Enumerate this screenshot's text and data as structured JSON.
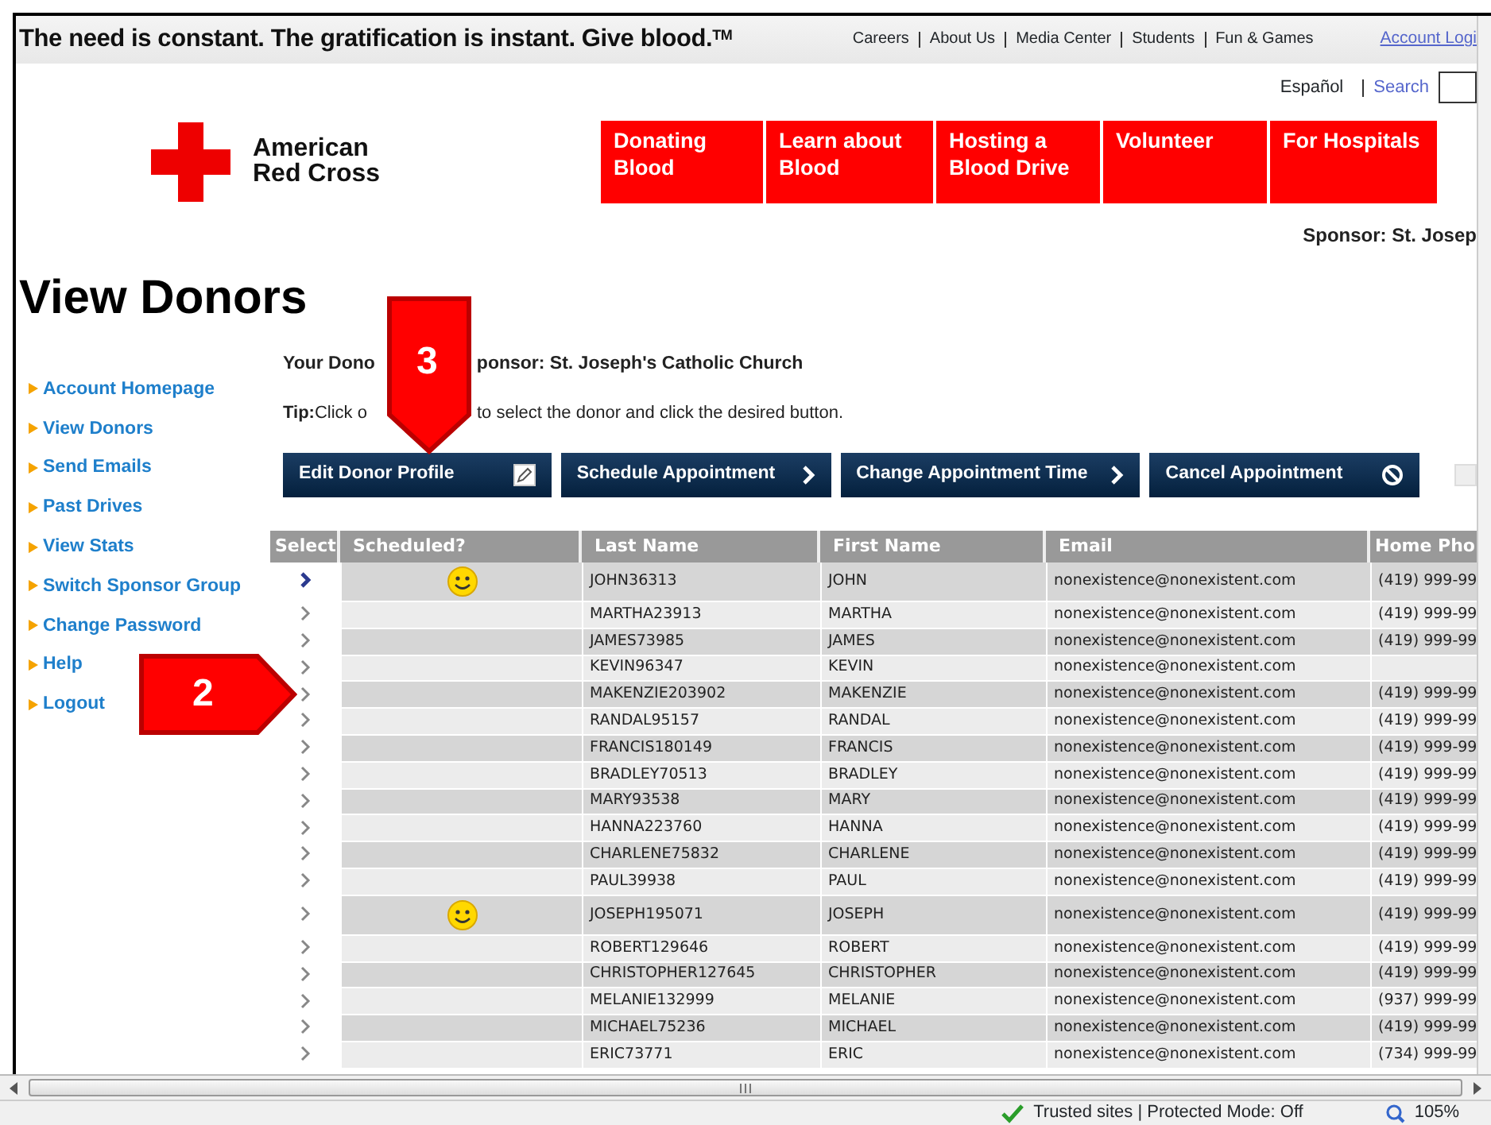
{
  "top_bar": {
    "tagline": "The need is constant. The gratification is instant. Give blood.$^{TM}$",
    "links": [
      "Careers",
      "About Us",
      "Media Center",
      "Students",
      "Fun & Games"
    ],
    "account_link": "Account Logi"
  },
  "utility_links": {
    "language": "Español",
    "search": "Search"
  },
  "logo": {
    "line1": "American",
    "line2": "Red Cross"
  },
  "main_nav": [
    {
      "label": "Donating Blood"
    },
    {
      "label": "Learn about Blood"
    },
    {
      "label": "Hosting a Blood Drive"
    },
    {
      "label": "Volunteer"
    },
    {
      "label": "For Hospitals"
    }
  ],
  "sponsor_heading": "Sponsor: St. Josep",
  "page_title": "View Donors",
  "sidebar": {
    "items": [
      "Account Homepage",
      "View Donors",
      "Send Emails",
      "Past Drives",
      "View Stats",
      "Switch Sponsor Group",
      "Change Password",
      "Help",
      "Logout"
    ]
  },
  "intro": {
    "parts": [
      "Your Dono",
      "ponsor: St. Joseph's Catholic Church"
    ]
  },
  "tip": {
    "label": "Tip:",
    "parts": [
      "Click o",
      "to select the donor and click the desired button."
    ]
  },
  "actions": [
    {
      "label": "Edit Donor Profile",
      "kind": "edit"
    },
    {
      "label": "Schedule Appointment",
      "kind": "next"
    },
    {
      "label": "Change Appointment Time",
      "kind": "next"
    },
    {
      "label": "Cancel Appointment",
      "kind": "cancel"
    }
  ],
  "table": {
    "columns": [
      "Select",
      "Scheduled?",
      "Last Name",
      "First Name",
      "Email",
      "Home Pho"
    ],
    "rows": [
      {
        "selected": true,
        "scheduled": true,
        "last": "JOHN36313",
        "first": "JOHN",
        "email": "nonexistence@nonexistent.com",
        "phone": "(419) 999-99"
      },
      {
        "selected": false,
        "scheduled": false,
        "last": "MARTHA23913",
        "first": "MARTHA",
        "email": "nonexistence@nonexistent.com",
        "phone": "(419) 999-99"
      },
      {
        "selected": false,
        "scheduled": false,
        "last": "JAMES73985",
        "first": "JAMES",
        "email": "nonexistence@nonexistent.com",
        "phone": "(419) 999-99"
      },
      {
        "selected": false,
        "scheduled": false,
        "last": "KEVIN96347",
        "first": "KEVIN",
        "email": "nonexistence@nonexistent.com"
      },
      {
        "selected": false,
        "scheduled": false,
        "last": "MAKENZIE203902",
        "first": "MAKENZIE",
        "email": "nonexistence@nonexistent.com",
        "phone": "(419) 999-99"
      },
      {
        "selected": false,
        "scheduled": false,
        "last": "RANDAL95157",
        "first": "RANDAL",
        "email": "nonexistence@nonexistent.com",
        "phone": "(419) 999-99"
      },
      {
        "selected": false,
        "scheduled": false,
        "last": "FRANCIS180149",
        "first": "FRANCIS",
        "email": "nonexistence@nonexistent.com",
        "phone": "(419) 999-99"
      },
      {
        "selected": false,
        "scheduled": false,
        "last": "BRADLEY70513",
        "first": "BRADLEY",
        "email": "nonexistence@nonexistent.com",
        "phone": "(419) 999-99"
      },
      {
        "selected": false,
        "scheduled": false,
        "last": "MARY93538",
        "first": "MARY",
        "email": "nonexistence@nonexistent.com",
        "phone": "(419) 999-99"
      },
      {
        "selected": false,
        "scheduled": false,
        "last": "HANNA223760",
        "first": "HANNA",
        "email": "nonexistence@nonexistent.com",
        "phone": "(419) 999-99"
      },
      {
        "selected": false,
        "scheduled": false,
        "last": "CHARLENE75832",
        "first": "CHARLENE",
        "email": "nonexistence@nonexistent.com",
        "phone": "(419) 999-99"
      },
      {
        "selected": false,
        "scheduled": false,
        "last": "PAUL39938",
        "first": "PAUL",
        "email": "nonexistence@nonexistent.com",
        "phone": "(419) 999-99"
      },
      {
        "selected": false,
        "scheduled": true,
        "last": "JOSEPH195071",
        "first": "JOSEPH",
        "email": "nonexistence@nonexistent.com",
        "phone": "(419) 999-99"
      },
      {
        "selected": false,
        "scheduled": false,
        "last": "ROBERT129646",
        "first": "ROBERT",
        "email": "nonexistence@nonexistent.com",
        "phone": "(419) 999-99"
      },
      {
        "selected": false,
        "scheduled": false,
        "last": "CHRISTOPHER127645",
        "first": "CHRISTOPHER",
        "email": "nonexistence@nonexistent.com",
        "phone": "(419) 999-99"
      },
      {
        "selected": false,
        "scheduled": false,
        "last": "MELANIE132999",
        "first": "MELANIE",
        "email": "nonexistence@nonexistent.com",
        "phone": "(937) 999-99"
      },
      {
        "selected": false,
        "scheduled": false,
        "last": "MICHAEL75236",
        "first": "MICHAEL",
        "email": "nonexistence@nonexistent.com",
        "phone": "(419) 999-99"
      },
      {
        "selected": false,
        "scheduled": false,
        "last": "ERIC73771",
        "first": "ERIC",
        "email": "nonexistence@nonexistent.com",
        "phone": "(734) 999-99"
      }
    ]
  },
  "callouts": [
    {
      "label": "3",
      "kind": "down"
    },
    {
      "label": "2",
      "kind": "right"
    }
  ],
  "status_bar": {
    "zone": "Trusted sites | Protected Mode: Off",
    "zoom": "105%"
  }
}
